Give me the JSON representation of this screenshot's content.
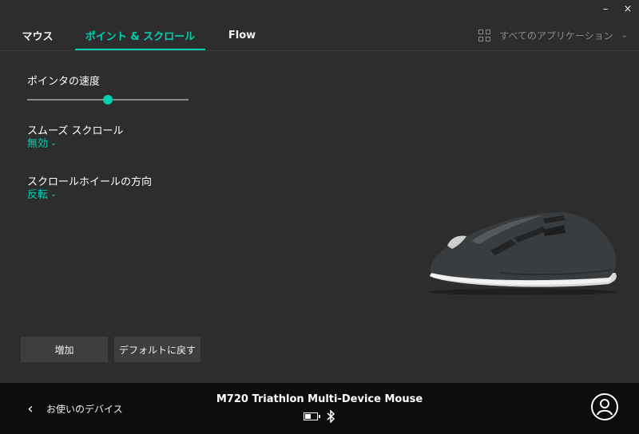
{
  "window": {
    "minimize": "–",
    "close": "×"
  },
  "tabs": [
    {
      "label": "マウス",
      "active": false
    },
    {
      "label": "ポイント & スクロール",
      "active": true
    },
    {
      "label": "Flow",
      "active": false
    }
  ],
  "app_filter": {
    "label": "すべてのアプリケーション",
    "icon": "grid-icon"
  },
  "settings": {
    "pointer_speed": {
      "label": "ポインタの速度",
      "value": 0.5
    },
    "smooth_scroll": {
      "label": "スムーズ スクロール",
      "value": "無効"
    },
    "scroll_direction": {
      "label": "スクロールホイールの方向",
      "value": "反転"
    }
  },
  "buttons": {
    "add": "増加",
    "reset": "デフォルトに戻す"
  },
  "footer": {
    "back_label": "お使いのデバイス",
    "device_name": "M720 Triathlon Multi-Device Mouse",
    "battery_level": 0.5
  },
  "colors": {
    "accent": "#00d1b2",
    "background": "#2d2d2d",
    "footer": "#0d0d0d"
  }
}
